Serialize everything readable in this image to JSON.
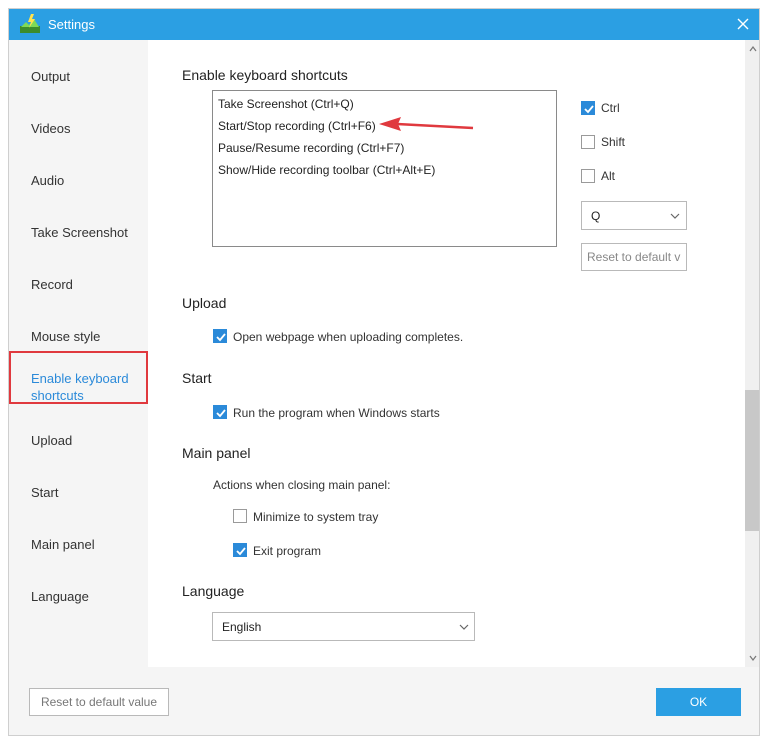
{
  "window": {
    "title": "Settings"
  },
  "sidebar": {
    "items": [
      {
        "label": "Output"
      },
      {
        "label": "Videos"
      },
      {
        "label": "Audio"
      },
      {
        "label": "Take Screenshot"
      },
      {
        "label": "Record"
      },
      {
        "label": "Mouse style"
      },
      {
        "label": "Enable keyboard shortcuts",
        "line1": "Enable keyboard",
        "line2": "shortcuts",
        "active": true
      },
      {
        "label": "Upload"
      },
      {
        "label": "Start"
      },
      {
        "label": "Main panel"
      },
      {
        "label": "Language"
      }
    ]
  },
  "shortcuts": {
    "title": "Enable keyboard shortcuts",
    "items": [
      "Take Screenshot (Ctrl+Q)",
      "Start/Stop recording (Ctrl+F6)",
      "Pause/Resume recording (Ctrl+F7)",
      "Show/Hide recording toolbar (Ctrl+Alt+E)"
    ],
    "modifiers": {
      "ctrl": {
        "label": "Ctrl",
        "checked": true
      },
      "shift": {
        "label": "Shift",
        "checked": false
      },
      "alt": {
        "label": "Alt",
        "checked": false
      }
    },
    "key_value": "Q",
    "reset_label": "Reset to default v"
  },
  "upload": {
    "title": "Upload",
    "open_webpage": {
      "label": "Open webpage when uploading completes.",
      "checked": true
    }
  },
  "start": {
    "title": "Start",
    "run_on_startup": {
      "label": "Run the program when Windows starts",
      "checked": true
    }
  },
  "main_panel": {
    "title": "Main panel",
    "subtitle": "Actions when closing main panel:",
    "minimize": {
      "label": "Minimize to system tray",
      "checked": false
    },
    "exit": {
      "label": "Exit program",
      "checked": true
    }
  },
  "language": {
    "title": "Language",
    "value": "English"
  },
  "footer": {
    "reset_label": "Reset to default value",
    "ok_label": "OK"
  },
  "colors": {
    "accent": "#2b9fe3",
    "checkbox": "#2b8ad9",
    "highlight": "#e0393e"
  }
}
